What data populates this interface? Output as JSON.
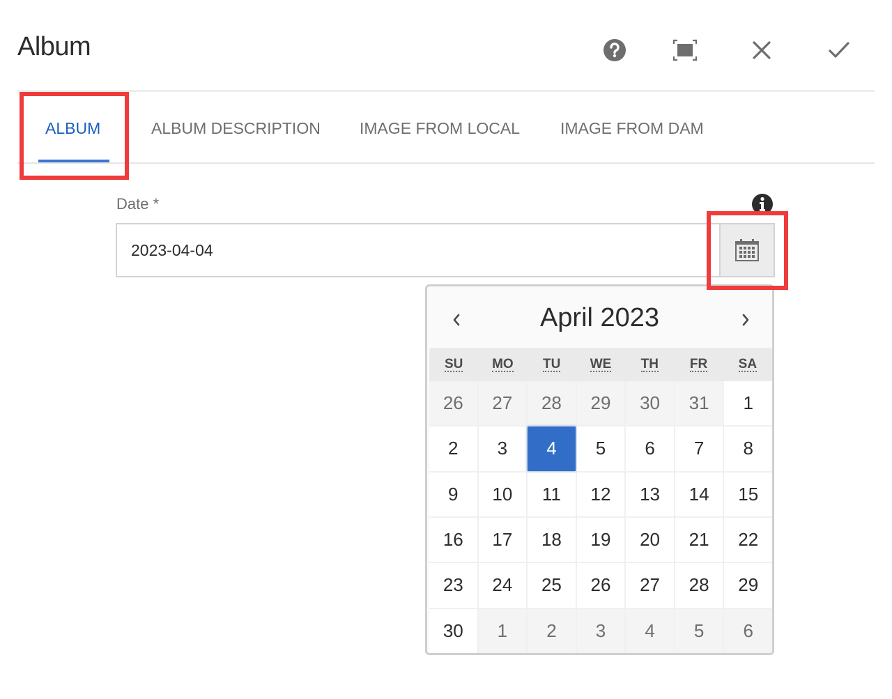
{
  "dialog": {
    "title": "Album",
    "actions": [
      {
        "name": "help",
        "icon": "help-icon"
      },
      {
        "name": "fullscreen",
        "icon": "fullscreen-icon"
      },
      {
        "name": "cancel",
        "icon": "close-icon"
      },
      {
        "name": "done",
        "icon": "check-icon"
      }
    ]
  },
  "tabs": [
    {
      "label": "ALBUM",
      "active": true
    },
    {
      "label": "ALBUM DESCRIPTION",
      "active": false
    },
    {
      "label": "IMAGE FROM LOCAL",
      "active": false
    },
    {
      "label": "IMAGE FROM DAM",
      "active": false
    }
  ],
  "date_field": {
    "label": "Date *",
    "value": "2023-04-04",
    "info_icon": "info-icon",
    "calendar_button_icon": "calendar-icon"
  },
  "datepicker": {
    "month_title": "April 2023",
    "prev_icon": "chevron-left-icon",
    "next_icon": "chevron-right-icon",
    "weekdays": [
      "SU",
      "MO",
      "TU",
      "WE",
      "TH",
      "FR",
      "SA"
    ],
    "weeks": [
      [
        {
          "d": "26",
          "o": true
        },
        {
          "d": "27",
          "o": true
        },
        {
          "d": "28",
          "o": true
        },
        {
          "d": "29",
          "o": true
        },
        {
          "d": "30",
          "o": true
        },
        {
          "d": "31",
          "o": true
        },
        {
          "d": "1"
        }
      ],
      [
        {
          "d": "2"
        },
        {
          "d": "3"
        },
        {
          "d": "4",
          "s": true
        },
        {
          "d": "5"
        },
        {
          "d": "6"
        },
        {
          "d": "7"
        },
        {
          "d": "8"
        }
      ],
      [
        {
          "d": "9"
        },
        {
          "d": "10"
        },
        {
          "d": "11"
        },
        {
          "d": "12"
        },
        {
          "d": "13"
        },
        {
          "d": "14"
        },
        {
          "d": "15"
        }
      ],
      [
        {
          "d": "16"
        },
        {
          "d": "17"
        },
        {
          "d": "18"
        },
        {
          "d": "19"
        },
        {
          "d": "20"
        },
        {
          "d": "21"
        },
        {
          "d": "22"
        }
      ],
      [
        {
          "d": "23"
        },
        {
          "d": "24"
        },
        {
          "d": "25"
        },
        {
          "d": "26"
        },
        {
          "d": "27"
        },
        {
          "d": "28"
        },
        {
          "d": "29"
        }
      ],
      [
        {
          "d": "30"
        },
        {
          "d": "1",
          "o": true
        },
        {
          "d": "2",
          "o": true
        },
        {
          "d": "3",
          "o": true
        },
        {
          "d": "4",
          "o": true
        },
        {
          "d": "5",
          "o": true
        },
        {
          "d": "6",
          "o": true
        }
      ]
    ],
    "selected_date": "2023-04-04"
  },
  "colors": {
    "accent": "#326ec8",
    "active_tab": "#1c5fc0",
    "highlight_box": "#ef3b3b"
  }
}
